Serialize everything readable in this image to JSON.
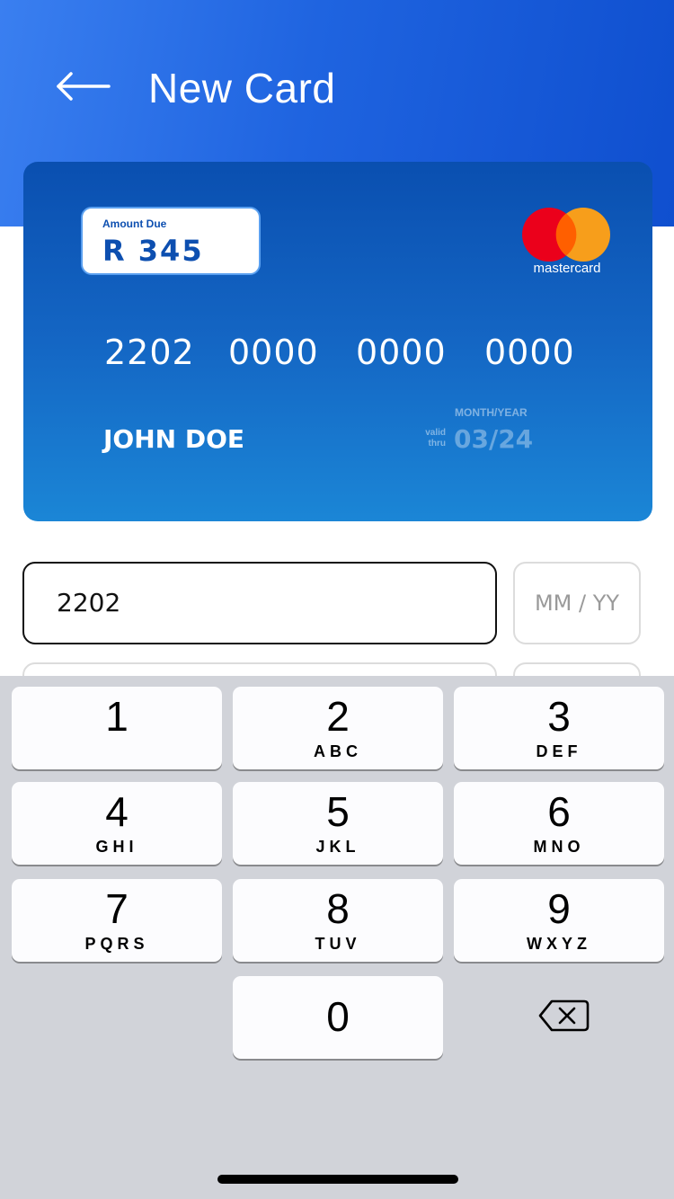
{
  "header": {
    "title": "New Card",
    "back_icon": "arrow-left-icon",
    "gradient_start": "#3a7ff0",
    "gradient_end": "#0f4fcf"
  },
  "card": {
    "amount_label": "Amount Due",
    "amount_value": "R 345",
    "brand": "mastercard",
    "number_groups": [
      "2202",
      "0000",
      "0000",
      "0000"
    ],
    "holder_name": "JOHN DOE",
    "month_year_label": "MONTH/YEAR",
    "valid_label_1": "valid",
    "valid_label_2": "thru",
    "expiry": "03/24",
    "colors": {
      "top": "#0a4fb0",
      "bottom": "#1b86d6",
      "mc_red": "#eb001b",
      "mc_orange": "#f79e1b",
      "mc_overlap": "#ff5f00"
    }
  },
  "form": {
    "card_number_value": "2202",
    "expiry_placeholder": "MM / YY"
  },
  "keyboard": {
    "keys": [
      {
        "digit": "1",
        "letters": ""
      },
      {
        "digit": "2",
        "letters": "ABC"
      },
      {
        "digit": "3",
        "letters": "DEF"
      },
      {
        "digit": "4",
        "letters": "GHI"
      },
      {
        "digit": "5",
        "letters": "JKL"
      },
      {
        "digit": "6",
        "letters": "MNO"
      },
      {
        "digit": "7",
        "letters": "PQRS"
      },
      {
        "digit": "8",
        "letters": "TUV"
      },
      {
        "digit": "9",
        "letters": "WXYZ"
      },
      {
        "digit": "0",
        "letters": ""
      }
    ],
    "delete_icon": "backspace-icon"
  }
}
